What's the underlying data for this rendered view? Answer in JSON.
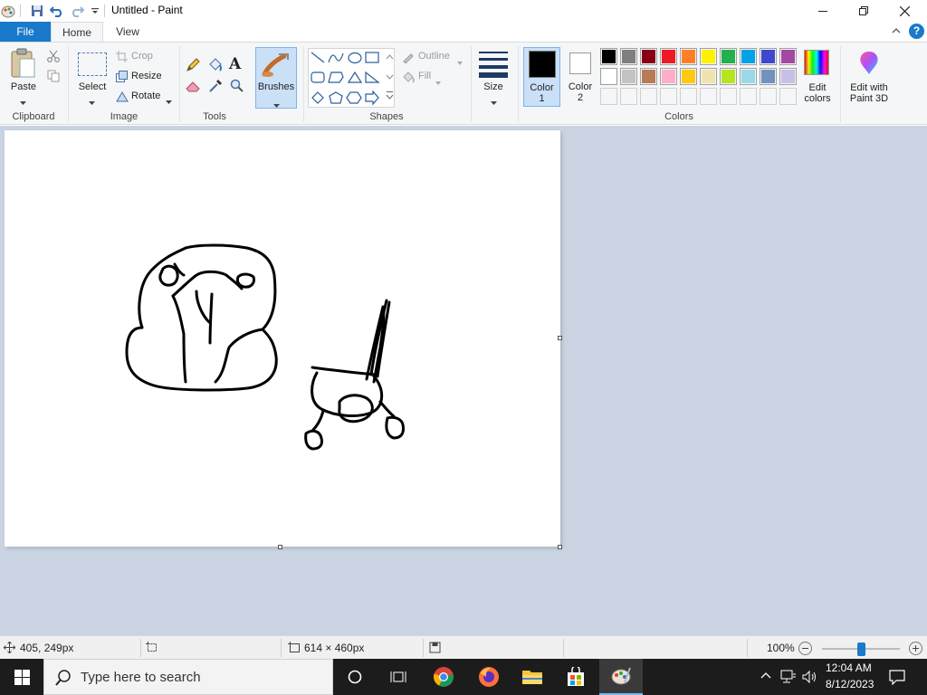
{
  "titlebar": {
    "title": "Untitled - Paint"
  },
  "tabs": {
    "file": "File",
    "home": "Home",
    "view": "View"
  },
  "ribbon": {
    "clipboard": {
      "paste": "Paste",
      "group": "Clipboard"
    },
    "image": {
      "select": "Select",
      "crop": "Crop",
      "resize": "Resize",
      "rotate": "Rotate",
      "group": "Image"
    },
    "tools": {
      "group": "Tools"
    },
    "brushes": {
      "label": "Brushes"
    },
    "shapes": {
      "outline": "Outline",
      "fill": "Fill",
      "group": "Shapes"
    },
    "size": {
      "label": "Size"
    },
    "colors": {
      "color1": "Color",
      "color1_num": "1",
      "color2": "Color",
      "color2_num": "2",
      "edit_colors_1": "Edit",
      "edit_colors_2": "colors",
      "paint3d_1": "Edit with",
      "paint3d_2": "Paint 3D",
      "group": "Colors",
      "palette_row1": [
        "#000000",
        "#7f7f7f",
        "#880015",
        "#ed1c24",
        "#ff7f27",
        "#fff200",
        "#22b14c",
        "#00a2e8",
        "#3f48cc",
        "#a349a4"
      ],
      "palette_row2": [
        "#ffffff",
        "#c3c3c3",
        "#b97a57",
        "#ffaec9",
        "#ffc90e",
        "#efe4b0",
        "#b5e61d",
        "#99d9ea",
        "#7092be",
        "#c8bfe7"
      ],
      "color1_value": "#000000",
      "color2_value": "#ffffff"
    }
  },
  "statusbar": {
    "cursor": "405, 249px",
    "canvas_size": "614 × 460px",
    "zoom": "100%",
    "zoom_level": 1.0
  },
  "taskbar": {
    "search_placeholder": "Type here to search",
    "time": "12:04 AM",
    "date": "8/12/2023"
  }
}
